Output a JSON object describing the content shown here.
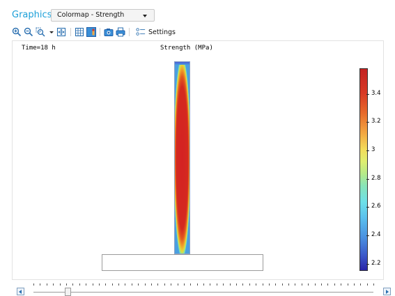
{
  "panel": {
    "title": "Graphics",
    "plot_group_select": {
      "selected": "Colormap - Strength"
    }
  },
  "toolbar": {
    "buttons": [
      {
        "name": "zoom-in-icon"
      },
      {
        "name": "zoom-out-icon"
      },
      {
        "name": "zoom-box-icon"
      },
      {
        "name": "zoom-extents-icon"
      },
      {
        "name": "grid-icon"
      },
      {
        "name": "show-legends-icon"
      },
      {
        "name": "camera-icon"
      },
      {
        "name": "print-icon"
      },
      {
        "name": "settings-icon"
      }
    ],
    "settings_label": "Settings"
  },
  "plot": {
    "time_label": "Time=18 h",
    "title": "Strength (MPa)"
  },
  "chart_data": {
    "type": "heatmap",
    "title": "Strength (MPa)",
    "quantity": "Strength",
    "unit": "MPa",
    "time": "18 h",
    "colorbar": {
      "ticks": [
        "3.4",
        "3.2",
        "3",
        "2.8",
        "2.6",
        "2.4",
        "2.2"
      ],
      "range": [
        2.15,
        3.58
      ],
      "colormap": "rainbow"
    }
  },
  "timeline": {
    "position": 0.1,
    "tick_count": 52
  },
  "colors": {
    "accent": "#1a9fd8",
    "high": "#c42222",
    "low": "#2a24a8"
  }
}
